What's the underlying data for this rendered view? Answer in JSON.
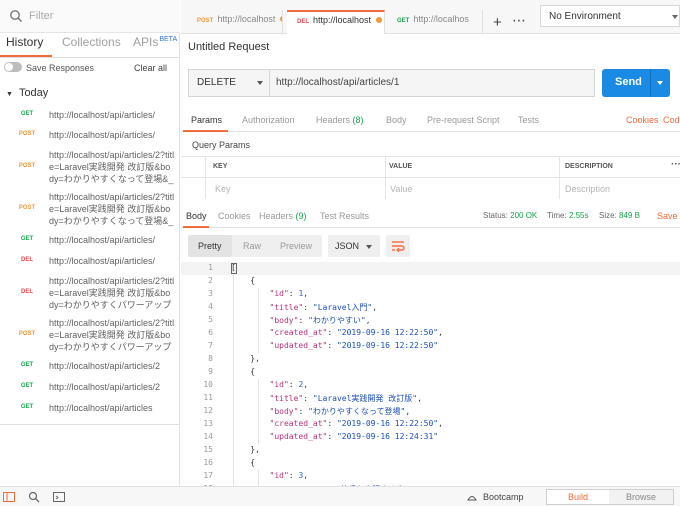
{
  "sidebar": {
    "filter_placeholder": "Filter",
    "tabs": [
      {
        "label": "History"
      },
      {
        "label": "Collections"
      },
      {
        "label": "APIs",
        "badge": "BETA"
      }
    ],
    "save_responses": "Save Responses",
    "clear_all": "Clear all",
    "group": "Today",
    "history": [
      {
        "method": "GET",
        "url": "http://localhost/api/articles/"
      },
      {
        "method": "POST",
        "url": "http://localhost/api/articles/"
      },
      {
        "method": "POST",
        "url": "http://localhost/api/articles/2?title=Laravel実践開発 改訂版&body=わかりやすくなって登場&_m"
      },
      {
        "method": "POST",
        "url": "http://localhost/api/articles/2?title=Laravel実践開発 改訂版&body=わかりやすくなって登場&_method="
      },
      {
        "method": "GET",
        "url": "http://localhost/api/articles/"
      },
      {
        "method": "DEL",
        "url": "http://localhost/api/articles/"
      },
      {
        "method": "DEL",
        "url": "http://localhost/api/articles/2?title=Laravel実践開発 改訂版&body=わかりやすくパワーアップ&"
      },
      {
        "method": "POST",
        "url": "http://localhost/api/articles/2?title=Laravel実践開発 改訂版&body=わかりやすくパワーアップ&"
      },
      {
        "method": "GET",
        "url": "http://localhost/api/articles/2"
      },
      {
        "method": "GET",
        "url": "http://localhost/api/articles/2"
      },
      {
        "method": "GET",
        "url": "http://localhost/api/articles"
      }
    ]
  },
  "tabs": [
    {
      "method": "POST",
      "label": "http://localhost"
    },
    {
      "method": "DEL",
      "label": "http://localhost"
    },
    {
      "method": "GET",
      "label": "http://localhos"
    }
  ],
  "environment": "No Environment",
  "request": {
    "title": "Untitled Request",
    "method": "DELETE",
    "url": "http://localhost/api/articles/1",
    "send": "Send",
    "tabs": {
      "params": "Params",
      "authorization": "Authorization",
      "headers": "Headers",
      "headers_count": "(8)",
      "body": "Body",
      "prerequest": "Pre-request Script",
      "tests": "Tests",
      "cookies": "Cookies",
      "code": "Code"
    },
    "query_params_title": "Query Params",
    "columns": {
      "key": "KEY",
      "value": "VALUE",
      "description": "DESCRIPTION"
    },
    "placeholders": {
      "key": "Key",
      "value": "Value",
      "description": "Description"
    }
  },
  "response": {
    "tabs": {
      "body": "Body",
      "cookies": "Cookies",
      "headers": "Headers",
      "headers_count": "(9)",
      "test_results": "Test Results"
    },
    "status_label": "Status:",
    "status_value": "200 OK",
    "time_label": "Time:",
    "time_value": "2.55s",
    "size_label": "Size:",
    "size_value": "849 B",
    "save": "Save",
    "views": {
      "pretty": "Pretty",
      "raw": "Raw",
      "preview": "Preview"
    },
    "format": "JSON",
    "lines": [
      "[",
      "    {",
      "        \"id\": 1,",
      "        \"title\": \"Laravel入門\",",
      "        \"body\": \"わかりやすい\",",
      "        \"created_at\": \"2019-09-16 12:22:50\",",
      "        \"updated_at\": \"2019-09-16 12:22:50\"",
      "    },",
      "    {",
      "        \"id\": 2,",
      "        \"title\": \"Laravel実践開発 改訂版\",",
      "        \"body\": \"わかりやすくなって登場\",",
      "        \"created_at\": \"2019-09-16 12:22:50\",",
      "        \"updated_at\": \"2019-09-16 12:24:31\"",
      "    },",
      "    {",
      "        \"id\": 3,",
      "        \"title\": \"SQLの苦手を克服する本\","
    ]
  },
  "statusbar": {
    "bootcamp": "Bootcamp",
    "build": "Build",
    "browse": "Browse"
  },
  "colors": {
    "accent": "#f26b3a",
    "send": "#1a8ae5",
    "get": "#16a34a",
    "post": "#f29a3c",
    "delete": "#e5484d"
  }
}
